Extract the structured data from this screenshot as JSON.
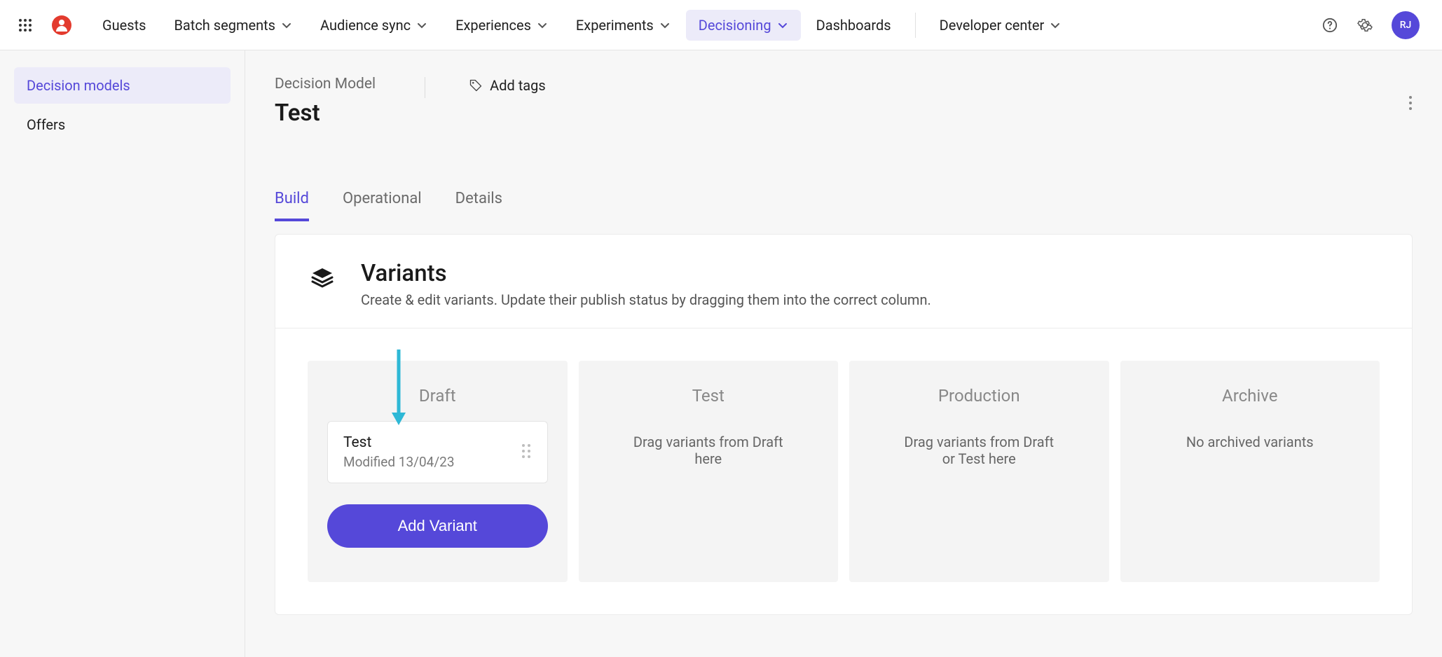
{
  "nav": {
    "items": [
      {
        "label": "Guests",
        "has_chevron": false
      },
      {
        "label": "Batch segments",
        "has_chevron": true
      },
      {
        "label": "Audience sync",
        "has_chevron": true
      },
      {
        "label": "Experiences",
        "has_chevron": true
      },
      {
        "label": "Experiments",
        "has_chevron": true
      },
      {
        "label": "Decisioning",
        "has_chevron": true,
        "active": true
      },
      {
        "label": "Dashboards",
        "has_chevron": false
      },
      {
        "label": "Developer center",
        "has_chevron": true
      }
    ],
    "avatar_initials": "RJ"
  },
  "sidebar": {
    "items": [
      {
        "label": "Decision models",
        "active": true
      },
      {
        "label": "Offers"
      }
    ]
  },
  "header": {
    "crumb": "Decision Model",
    "title": "Test",
    "add_tags_label": "Add tags"
  },
  "tabs": [
    {
      "label": "Build",
      "active": true
    },
    {
      "label": "Operational"
    },
    {
      "label": "Details"
    }
  ],
  "panel": {
    "title": "Variants",
    "subtitle": "Create & edit variants. Update their publish status by dragging them into the correct column."
  },
  "columns": {
    "draft": {
      "title": "Draft",
      "variant": {
        "name": "Test",
        "modified": "Modified 13/04/23"
      },
      "add_button": "Add Variant"
    },
    "test": {
      "title": "Test",
      "empty": "Drag variants from Draft here"
    },
    "production": {
      "title": "Production",
      "empty": "Drag variants from Draft or Test here"
    },
    "archive": {
      "title": "Archive",
      "empty": "No archived variants"
    }
  }
}
